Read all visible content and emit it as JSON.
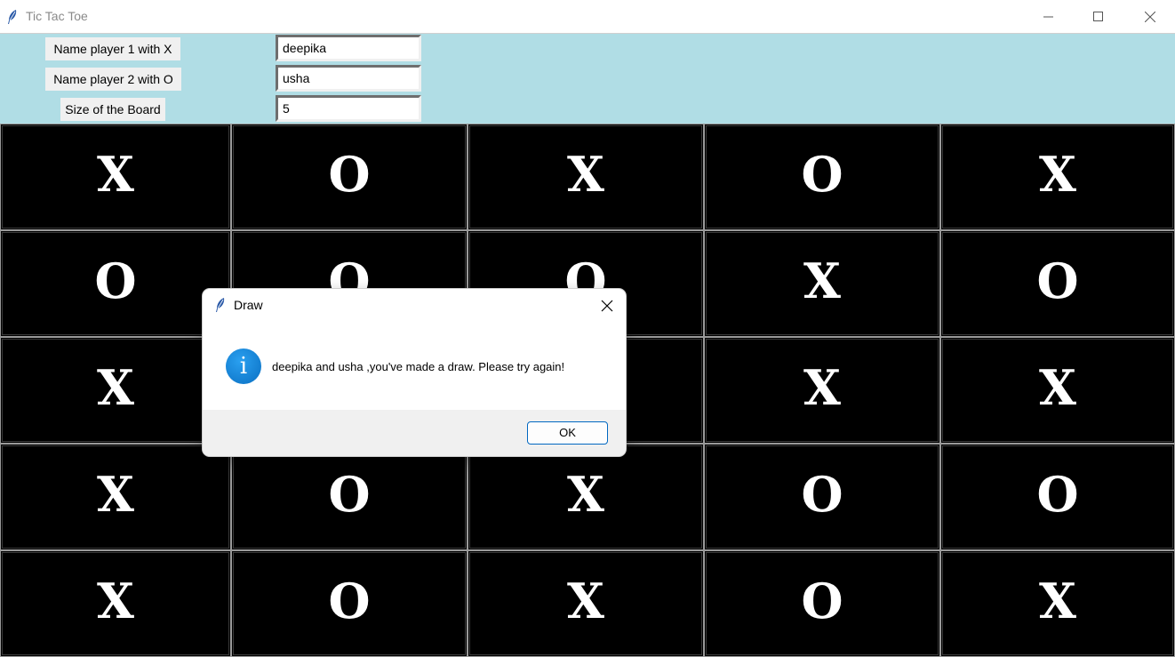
{
  "window": {
    "title": "Tic Tac Toe",
    "icon": "feather-icon",
    "controls": [
      "minimize-icon",
      "maximize-icon",
      "close-icon"
    ]
  },
  "config": {
    "player1_label": "Name player 1 with X",
    "player1_value": "deepika",
    "player2_label": "Name player 2 with O",
    "player2_value": "usha",
    "size_label": "Size of the Board",
    "size_value": "5"
  },
  "board": {
    "rows": [
      [
        "X",
        "O",
        "X",
        "O",
        "X"
      ],
      [
        "O",
        "O",
        "O",
        "X",
        "O"
      ],
      [
        "X",
        "",
        "",
        "X",
        "X"
      ],
      [
        "X",
        "O",
        "X",
        "O",
        "O"
      ],
      [
        "X",
        "O",
        "X",
        "O",
        "X"
      ]
    ]
  },
  "dialog": {
    "title": "Draw",
    "icon": "info-icon",
    "message": "deepika and usha ,you've made a draw. Please try again!",
    "ok_label": "OK"
  },
  "colors": {
    "panel_bg": "#b0dde5",
    "cell_bg": "#000000",
    "mark": "#ffffff",
    "accent": "#0067c0"
  }
}
